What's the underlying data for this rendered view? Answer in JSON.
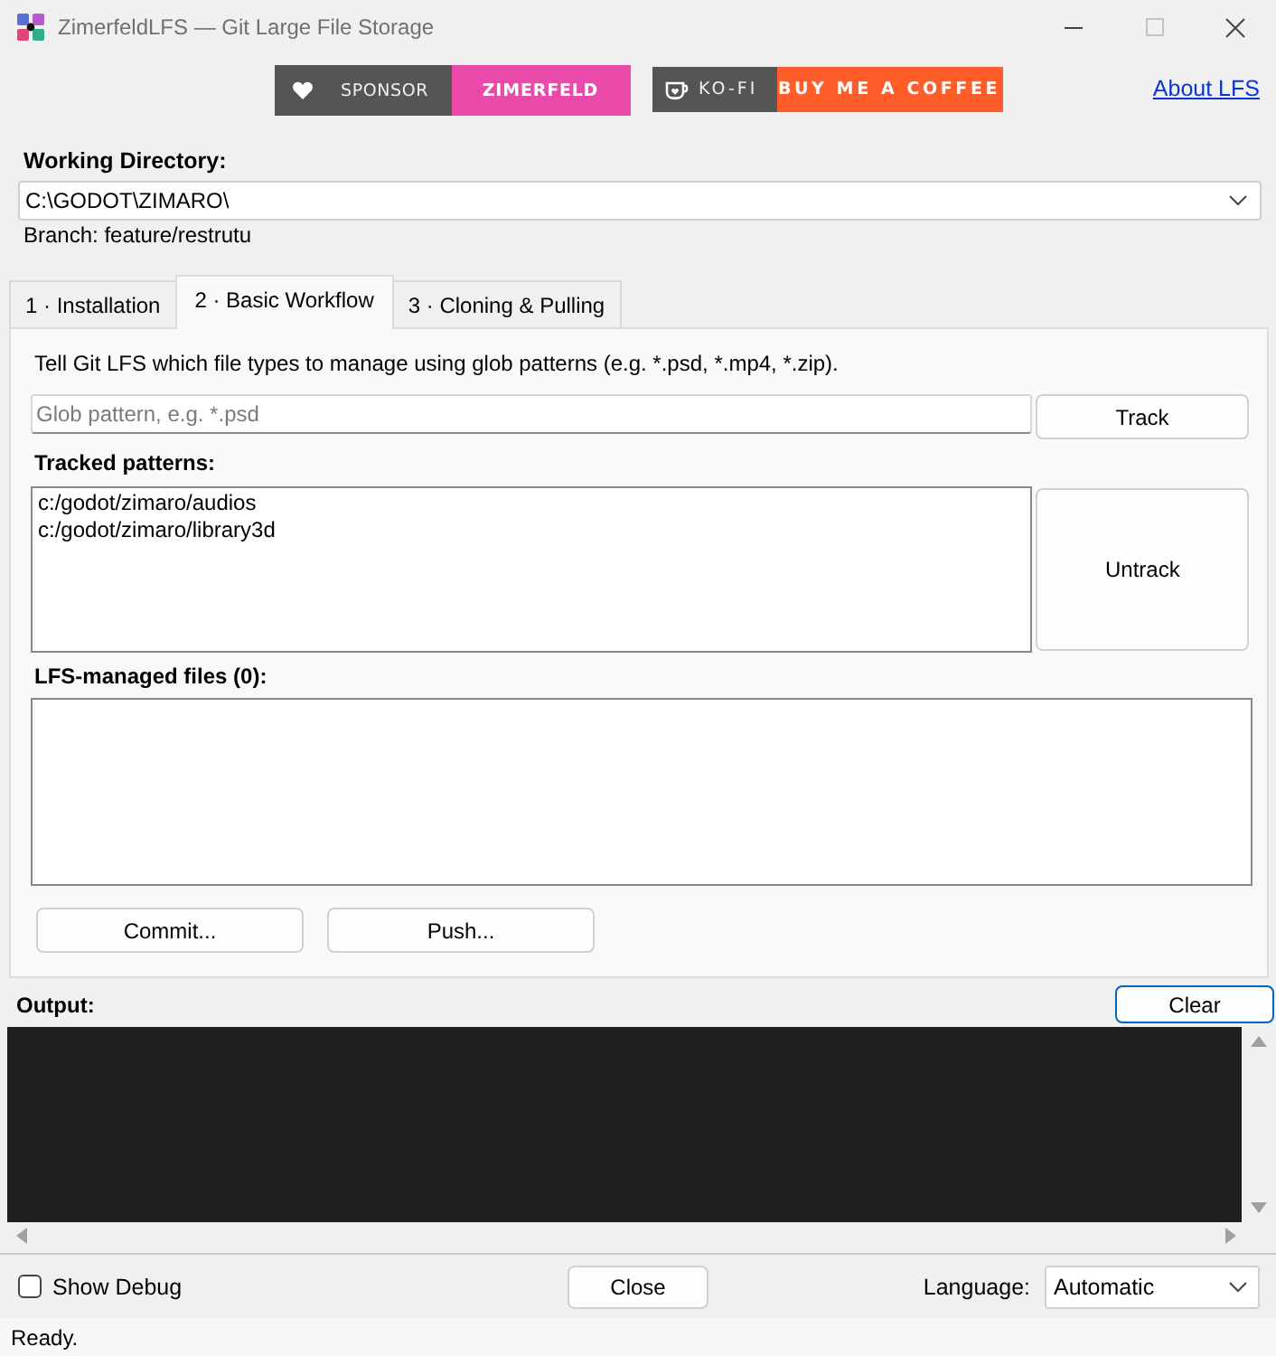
{
  "window": {
    "title": "ZimerfeldLFS — Git Large File Storage"
  },
  "header": {
    "sponsor_badge": {
      "label": "SPONSOR",
      "name": "ZIMERFELD"
    },
    "kofi_badge": {
      "label": "KO-FI",
      "action": "BUY ME A COFFEE"
    },
    "about_link": "About LFS"
  },
  "working_directory": {
    "label": "Working Directory:",
    "value": "C:\\GODOT\\ZIMARO\\",
    "branch": "Branch: feature/restrutu"
  },
  "tabs": [
    {
      "label": "1 · Installation",
      "selected": false
    },
    {
      "label": "2 · Basic Workflow",
      "selected": true
    },
    {
      "label": "3 · Cloning & Pulling",
      "selected": false
    }
  ],
  "panel": {
    "description": "Tell Git LFS which file types to manage using glob patterns (e.g. *.psd, *.mp4, *.zip).",
    "glob_field": {
      "placeholder": "Glob pattern, e.g. *.psd"
    },
    "track_button": "Track",
    "tracked_label": "Tracked patterns:",
    "tracked_patterns": [
      "c:/godot/zimaro/audios",
      "c:/godot/zimaro/library3d"
    ],
    "untrack_button": "Untrack",
    "files_label": "LFS-managed files (0):",
    "commit_button": "Commit...",
    "push_button": "Push..."
  },
  "output": {
    "label": "Output:",
    "clear_button": "Clear"
  },
  "footer": {
    "show_debug": {
      "label": "Show Debug",
      "checked": false
    },
    "close_button": "Close",
    "language": {
      "label": "Language:",
      "value": "Automatic"
    }
  },
  "status_bar": "Ready."
}
